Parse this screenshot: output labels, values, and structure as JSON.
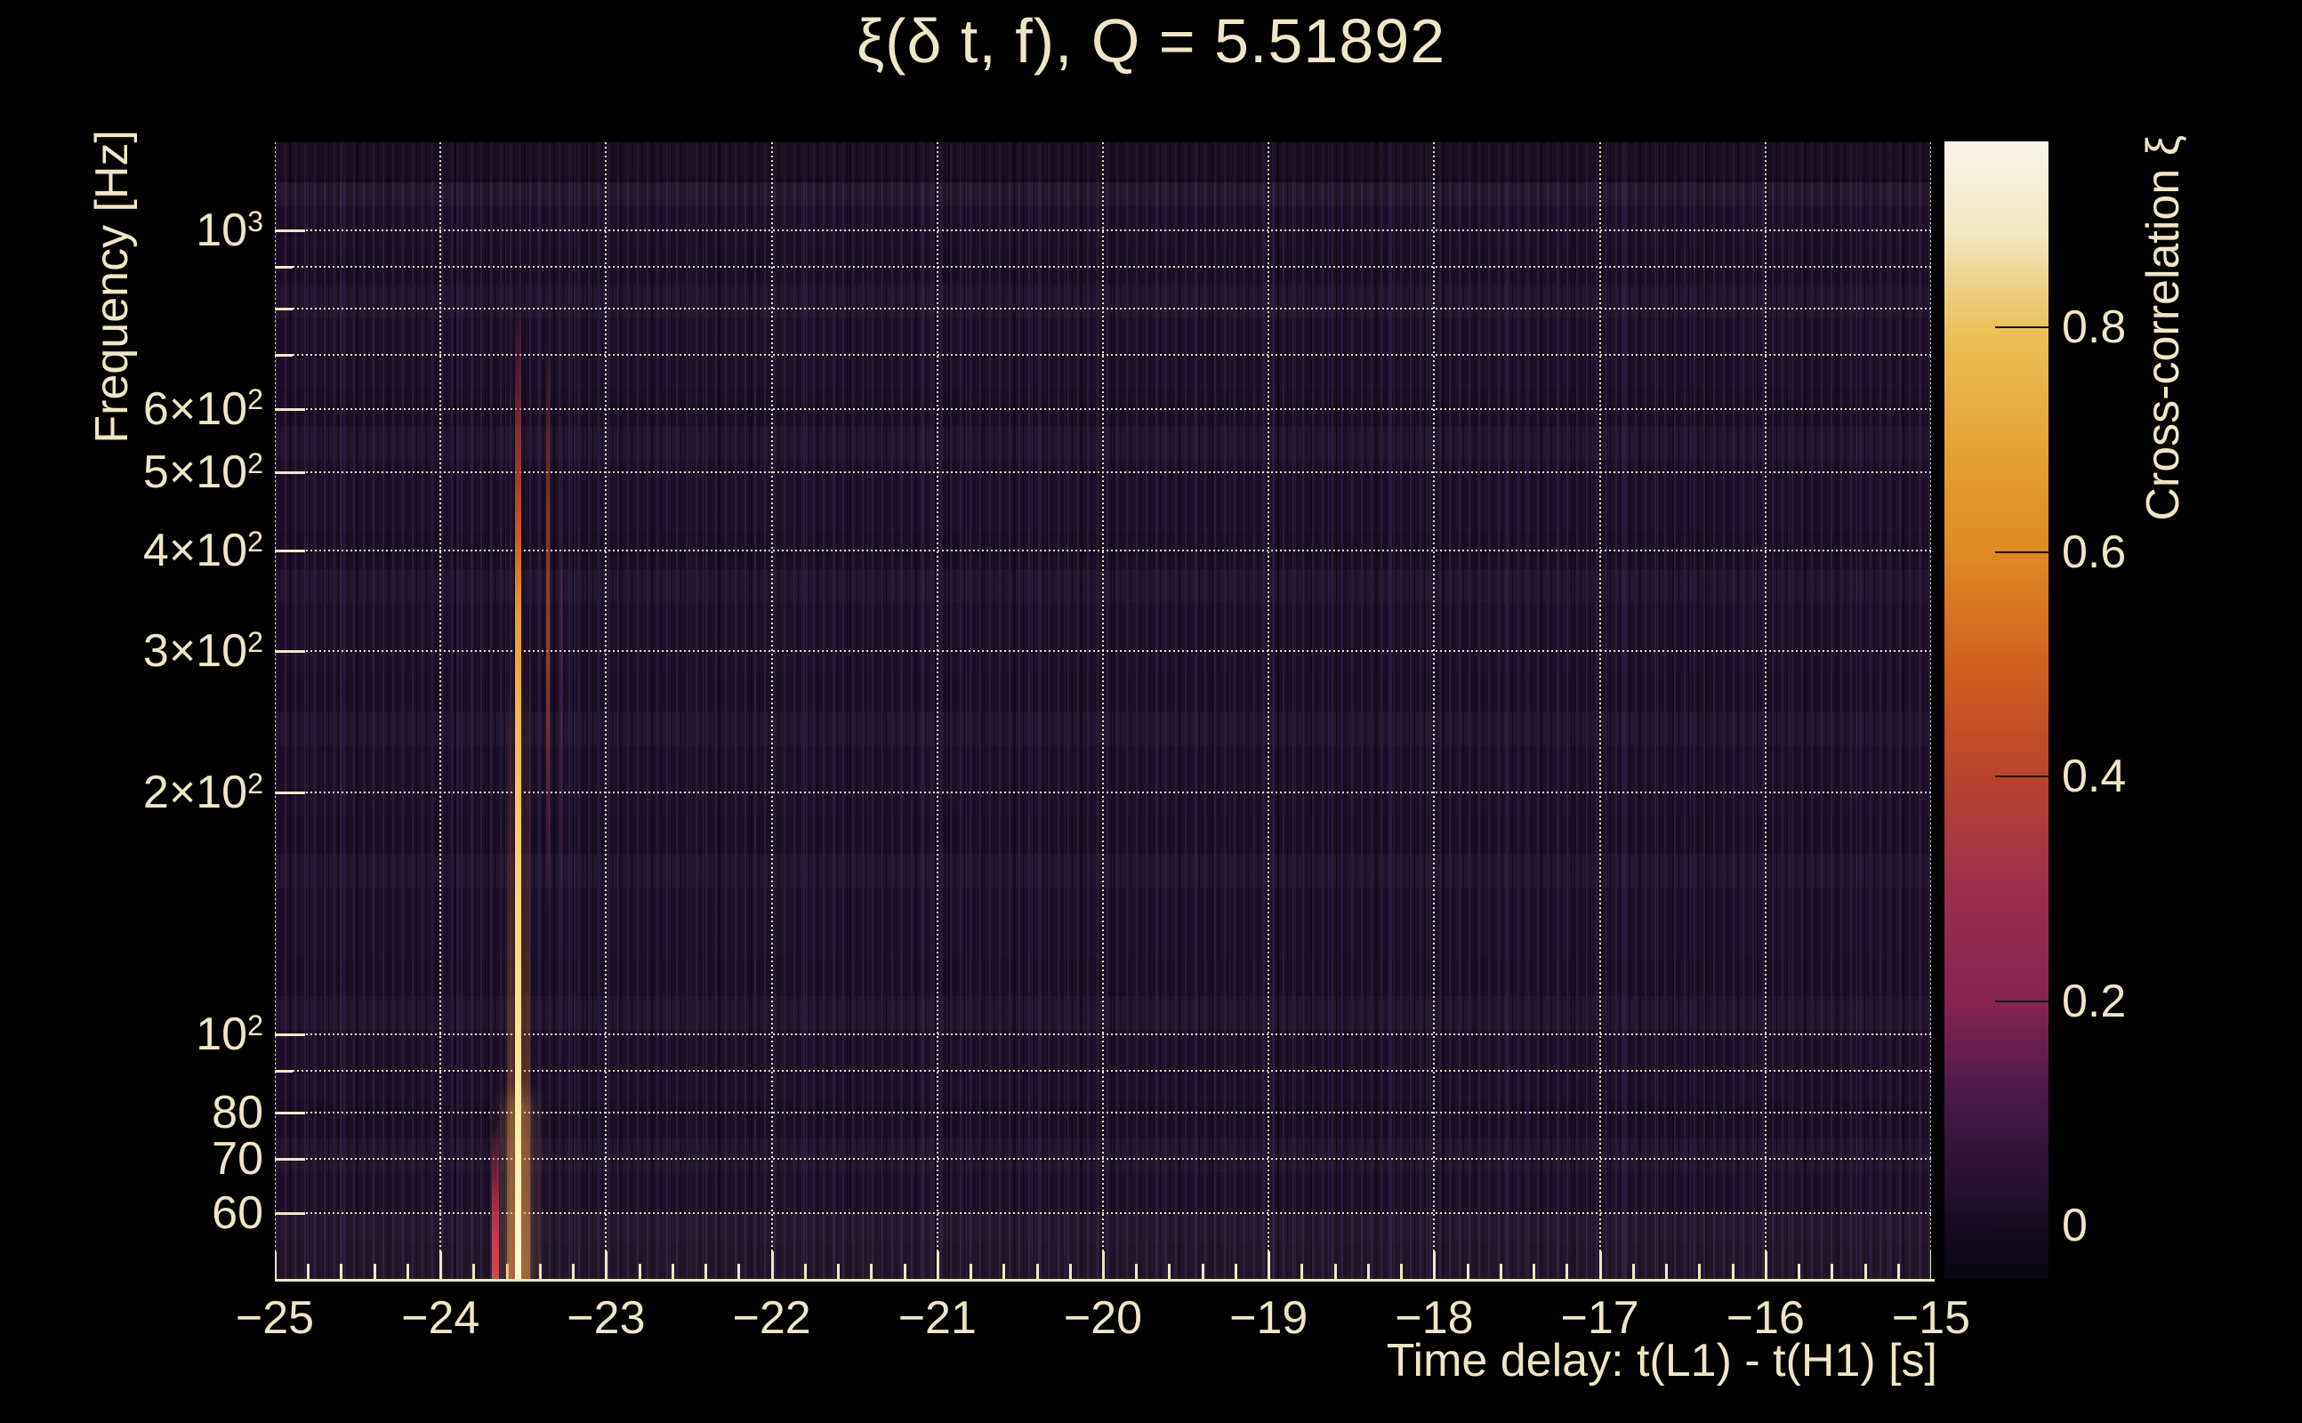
{
  "title": "ξ(δ t, f), Q = 5.51892",
  "axes": {
    "x": {
      "title": "Time delay: t(L1) - t(H1) [s]",
      "min": -25,
      "max": -15,
      "major_tick_step_s": 1,
      "minor_tick_step_s": 0.2,
      "ticks": [
        {
          "label": "−25",
          "value": -25
        },
        {
          "label": "−24",
          "value": -24
        },
        {
          "label": "−23",
          "value": -23
        },
        {
          "label": "−22",
          "value": -22
        },
        {
          "label": "−21",
          "value": -21
        },
        {
          "label": "−20",
          "value": -20
        },
        {
          "label": "−19",
          "value": -19
        },
        {
          "label": "−18",
          "value": -18
        },
        {
          "label": "−17",
          "value": -17
        },
        {
          "label": "−16",
          "value": -16
        },
        {
          "label": "−15",
          "value": -15
        }
      ]
    },
    "y": {
      "title": "Frequency [Hz]",
      "scale": "log",
      "min_hz": 49,
      "max_hz": 1290,
      "grid": [
        {
          "hz": 1000,
          "label": {
            "base": "10",
            "sup": "3"
          }
        },
        {
          "hz": 900,
          "label": null
        },
        {
          "hz": 800,
          "label": null
        },
        {
          "hz": 700,
          "label": null
        },
        {
          "hz": 600,
          "label": {
            "base": "6×10",
            "sup": "2"
          }
        },
        {
          "hz": 500,
          "label": {
            "base": "5×10",
            "sup": "2"
          }
        },
        {
          "hz": 400,
          "label": {
            "base": "4×10",
            "sup": "2"
          }
        },
        {
          "hz": 300,
          "label": {
            "base": "3×10",
            "sup": "2"
          }
        },
        {
          "hz": 200,
          "label": {
            "base": "2×10",
            "sup": "2"
          }
        },
        {
          "hz": 100,
          "label": {
            "base": "10",
            "sup": "2"
          }
        },
        {
          "hz": 90,
          "label": null
        },
        {
          "hz": 80,
          "label": {
            "base": "80",
            "sup": ""
          }
        },
        {
          "hz": 70,
          "label": {
            "base": "70",
            "sup": ""
          }
        },
        {
          "hz": 60,
          "label": {
            "base": "60",
            "sup": ""
          }
        }
      ]
    }
  },
  "colorbar": {
    "title": "Cross-correlation ξ",
    "value_min": -0.05,
    "value_max": 0.96,
    "ticks": [
      {
        "label": "0",
        "value": 0
      },
      {
        "label": "0.2",
        "value": 0.2
      },
      {
        "label": "0.4",
        "value": 0.4
      },
      {
        "label": "0.6",
        "value": 0.6
      },
      {
        "label": "0.8",
        "value": 0.8
      }
    ],
    "gradient": [
      {
        "pos": 0.0,
        "color": "#f7f3e9"
      },
      {
        "pos": 0.08,
        "color": "#f3e7c2"
      },
      {
        "pos": 0.17,
        "color": "#eabf55"
      },
      {
        "pos": 0.27,
        "color": "#e5a335"
      },
      {
        "pos": 0.36,
        "color": "#df8a23"
      },
      {
        "pos": 0.46,
        "color": "#d2611f"
      },
      {
        "pos": 0.56,
        "color": "#b8432c"
      },
      {
        "pos": 0.66,
        "color": "#9c2e4e"
      },
      {
        "pos": 0.76,
        "color": "#862451"
      },
      {
        "pos": 0.83,
        "color": "#4d1a4c"
      },
      {
        "pos": 0.91,
        "color": "#2a1135"
      },
      {
        "pos": 0.955,
        "color": "#160b22"
      },
      {
        "pos": 1.0,
        "color": "#0a0512"
      }
    ]
  },
  "colors": {
    "canvas_bg": "#000000",
    "plot_bg": "#1e1029",
    "text": "#f0e6c4",
    "grid_dots": "#f6ecd0",
    "axis_line": "#f0e6c4",
    "colorbar_tick": "#131313",
    "ridge_core": "#fff7d4",
    "ridge_orange": "#e89a33"
  },
  "chart_data": {
    "type": "heatmap",
    "title": "ξ(δ t, f), Q = 5.51892",
    "q_value": 5.51892,
    "xlabel": "Time delay: t(L1) - t(H1) [s]",
    "ylabel": "Frequency [Hz]",
    "colorbar_label": "Cross-correlation ξ",
    "x_range_s": [
      -25,
      -15
    ],
    "y_range_hz": [
      49,
      1290
    ],
    "y_scale": "log",
    "x_tick_values": [
      -25,
      -24,
      -23,
      -22,
      -21,
      -20,
      -19,
      -18,
      -17,
      -16,
      -15
    ],
    "y_tick_values_hz": [
      1000,
      600,
      500,
      400,
      300,
      200,
      100,
      80,
      70,
      60
    ],
    "color_scale_range": [
      -0.05,
      0.96
    ],
    "colorbar_tick_values": [
      0,
      0.2,
      0.4,
      0.6,
      0.8
    ],
    "background_xi_level": 0.02,
    "features": [
      {
        "name": "primary-ridge",
        "delta_t_s": -23.53,
        "freq_span_hz": [
          50,
          900
        ],
        "peak_xi": 0.95,
        "note": "narrow bright vertical ridge; orange at mid frequencies, near-white below 100 Hz"
      },
      {
        "name": "secondary-ridge",
        "delta_t_s": -23.35,
        "freq_span_hz": [
          90,
          650
        ],
        "peak_xi": 0.45,
        "note": "fainter orange streak right of the primary ridge"
      },
      {
        "name": "left-satellite-streak",
        "delta_t_s": -23.67,
        "freq_span_hz": [
          50,
          72
        ],
        "peak_xi": 0.35,
        "note": "short crimson streak left of the primary ridge near the bottom edge"
      },
      {
        "name": "right-faint-streak",
        "delta_t_s": -23.27,
        "freq_span_hz": [
          90,
          450
        ],
        "peak_xi": 0.12,
        "note": "very faint purple streak"
      }
    ]
  }
}
